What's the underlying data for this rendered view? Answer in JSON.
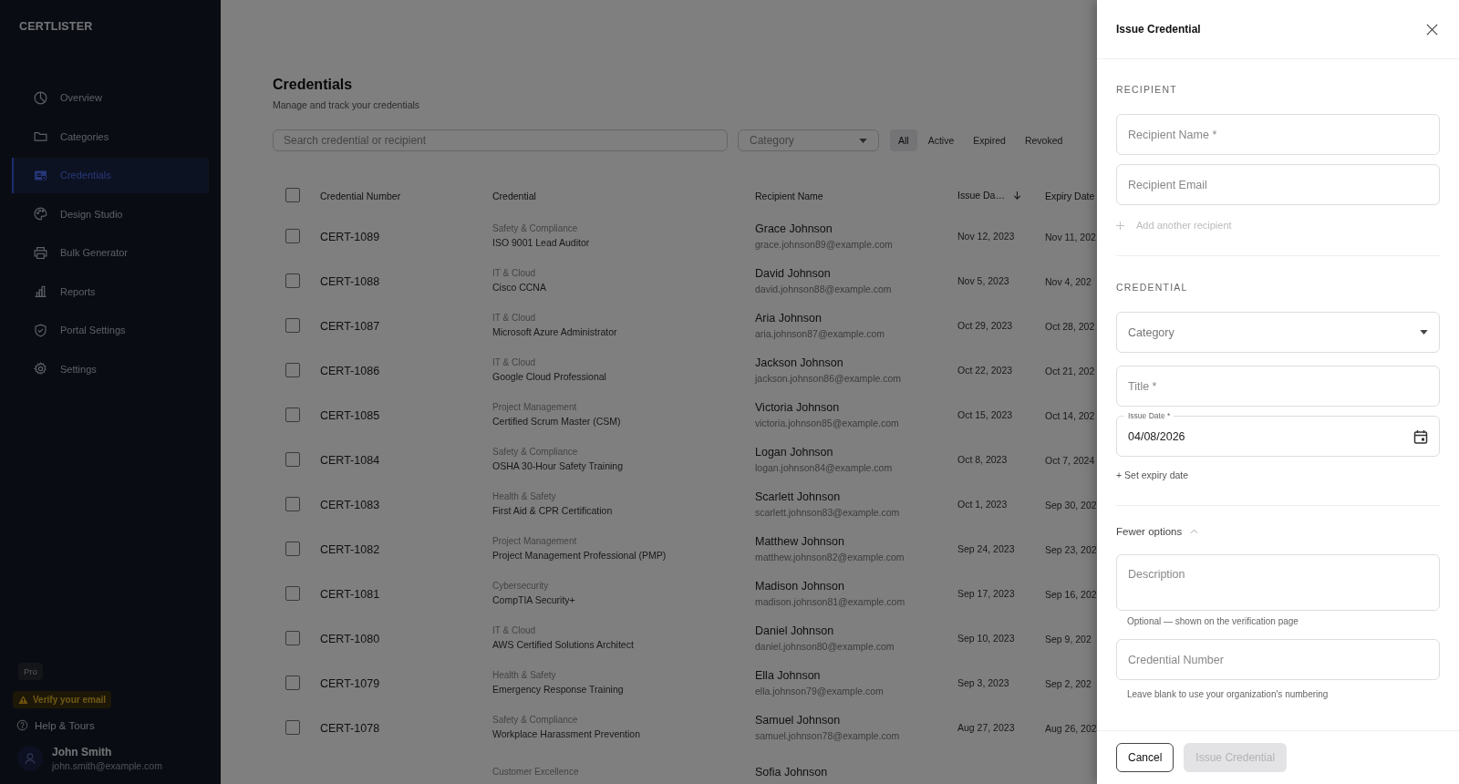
{
  "sidebar": {
    "logo": "CERTLISTER",
    "items": [
      {
        "label": "Overview",
        "selected": false
      },
      {
        "label": "Categories",
        "selected": false
      },
      {
        "label": "Credentials",
        "selected": true
      },
      {
        "label": "Design Studio",
        "selected": false
      },
      {
        "label": "Bulk Generator",
        "selected": false
      },
      {
        "label": "Reports",
        "selected": false
      },
      {
        "label": "Portal Settings",
        "selected": false
      },
      {
        "label": "Settings",
        "selected": false
      }
    ],
    "plan_badge": "Pro",
    "verify_notice": "Verify your email",
    "help": "Help & Tours",
    "user": {
      "name": "John Smith",
      "email": "john.smith@example.com"
    }
  },
  "page": {
    "title": "Credentials",
    "subtitle": "Manage and track your credentials",
    "search": {
      "placeholder": "Search credential or recipient"
    },
    "category_filter": {
      "placeholder": "Category"
    },
    "status_tabs": [
      {
        "label": "All",
        "selected": true
      },
      {
        "label": "Active",
        "selected": false
      },
      {
        "label": "Expired",
        "selected": false
      },
      {
        "label": "Revoked",
        "selected": false
      }
    ]
  },
  "table": {
    "select_all": {
      "checked": false
    },
    "columns": [
      "Credential Number",
      "Credential",
      "Recipient Name",
      "Issue Da…",
      "Expiry Date"
    ],
    "rows": [
      {
        "checked": false,
        "number": "CERT-1089",
        "category": "Safety & Compliance",
        "credential": "ISO 9001 Lead Auditor",
        "name": "Grace Johnson",
        "email": "grace.johnson89@example.com",
        "issued": "Nov 12, 2023",
        "expiry": "Nov 11, 202"
      },
      {
        "checked": false,
        "number": "CERT-1088",
        "category": "IT & Cloud",
        "credential": "Cisco CCNA",
        "name": "David Johnson",
        "email": "david.johnson88@example.com",
        "issued": "Nov 5, 2023",
        "expiry": "Nov 4, 202"
      },
      {
        "checked": false,
        "number": "CERT-1087",
        "category": "IT & Cloud",
        "credential": "Microsoft Azure Administrator",
        "name": "Aria Johnson",
        "email": "aria.johnson87@example.com",
        "issued": "Oct 29, 2023",
        "expiry": "Oct 28, 202"
      },
      {
        "checked": false,
        "number": "CERT-1086",
        "category": "IT & Cloud",
        "credential": "Google Cloud Professional",
        "name": "Jackson Johnson",
        "email": "jackson.johnson86@example.com",
        "issued": "Oct 22, 2023",
        "expiry": "Oct 21, 202"
      },
      {
        "checked": false,
        "number": "CERT-1085",
        "category": "Project Management",
        "credential": "Certified Scrum Master (CSM)",
        "name": "Victoria Johnson",
        "email": "victoria.johnson85@example.com",
        "issued": "Oct 15, 2023",
        "expiry": "Oct 14, 202"
      },
      {
        "checked": false,
        "number": "CERT-1084",
        "category": "Safety & Compliance",
        "credential": "OSHA 30-Hour Safety Training",
        "name": "Logan Johnson",
        "email": "logan.johnson84@example.com",
        "issued": "Oct 8, 2023",
        "expiry": "Oct 7, 2024"
      },
      {
        "checked": false,
        "number": "CERT-1083",
        "category": "Health & Safety",
        "credential": "First Aid & CPR Certification",
        "name": "Scarlett Johnson",
        "email": "scarlett.johnson83@example.com",
        "issued": "Oct 1, 2023",
        "expiry": "Sep 30, 202"
      },
      {
        "checked": false,
        "number": "CERT-1082",
        "category": "Project Management",
        "credential": "Project Management Professional (PMP)",
        "name": "Matthew Johnson",
        "email": "matthew.johnson82@example.com",
        "issued": "Sep 24, 2023",
        "expiry": "Sep 23, 202"
      },
      {
        "checked": false,
        "number": "CERT-1081",
        "category": "Cybersecurity",
        "credential": "CompTIA Security+",
        "name": "Madison Johnson",
        "email": "madison.johnson81@example.com",
        "issued": "Sep 17, 2023",
        "expiry": "Sep 16, 202"
      },
      {
        "checked": false,
        "number": "CERT-1080",
        "category": "IT & Cloud",
        "credential": "AWS Certified Solutions Architect",
        "name": "Daniel Johnson",
        "email": "daniel.johnson80@example.com",
        "issued": "Sep 10, 2023",
        "expiry": "Sep 9, 202"
      },
      {
        "checked": false,
        "number": "CERT-1079",
        "category": "Health & Safety",
        "credential": "Emergency Response Training",
        "name": "Ella Johnson",
        "email": "ella.johnson79@example.com",
        "issued": "Sep 3, 2023",
        "expiry": "Sep 2, 202"
      },
      {
        "checked": false,
        "number": "CERT-1078",
        "category": "Safety & Compliance",
        "credential": "Workplace Harassment Prevention",
        "name": "Samuel Johnson",
        "email": "samuel.johnson78@example.com",
        "issued": "Aug 27, 2023",
        "expiry": "Aug 26, 202"
      },
      {
        "category": "Customer Excellence",
        "name": "Sofia Johnson"
      }
    ]
  },
  "drawer": {
    "title": "Issue Credential",
    "recipient_section": "RECIPIENT",
    "recipient_fields": [
      {
        "kind": "input",
        "placeholder": "Recipient Name *"
      },
      {
        "kind": "input",
        "placeholder": "Recipient Email"
      }
    ],
    "add_recipient": "Add another recipient",
    "credential_section": "CREDENTIAL",
    "credential_fields": [
      {
        "kind": "select",
        "placeholder": "Category"
      },
      {
        "kind": "input",
        "placeholder": "Title *"
      },
      {
        "kind": "date",
        "label": "Issue Date *",
        "value": "04/08/2026"
      }
    ],
    "set_expiry": "+ Set expiry date",
    "options_toggle": {
      "label": "Fewer options",
      "expanded": true
    },
    "extra_fields": [
      {
        "kind": "textarea",
        "placeholder": "Description",
        "helper": "Optional — shown on the verification page"
      },
      {
        "kind": "input",
        "placeholder": "Credential Number",
        "helper": "Leave blank to use your organization's numbering"
      }
    ],
    "cancel": "Cancel",
    "submit": {
      "label": "Issue Credential",
      "disabled": true
    }
  }
}
